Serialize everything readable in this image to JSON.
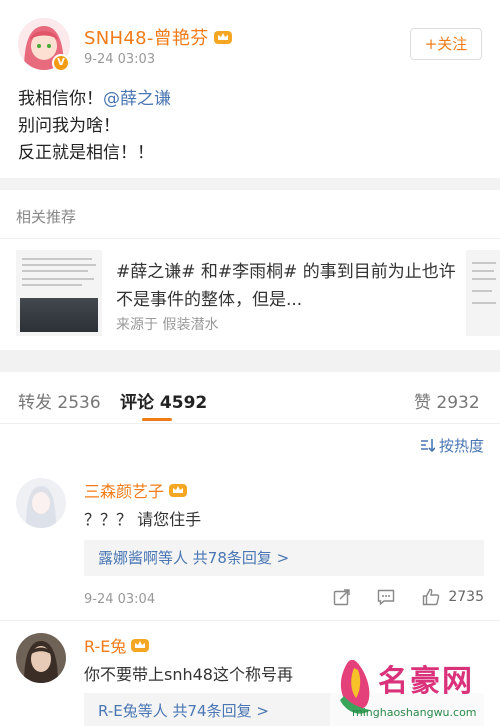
{
  "post": {
    "username": "SNH48-曾艳芬",
    "time": "9-24 03:03",
    "follow_label": "+关注",
    "lines": [
      "我相信你！",
      "别问我为啥！",
      "反正就是相信！！"
    ],
    "mention": "@薛之谦"
  },
  "related": {
    "title": "相关推荐",
    "card_text": "#薛之谦# 和#李雨桐# 的事到目前为止也许不是事件的整体，但是...",
    "card_source": "来源于 假装潜水"
  },
  "tabs": {
    "repost_label": "转发",
    "repost_count": "2536",
    "comment_label": "评论",
    "comment_count": "4592",
    "like_label": "赞",
    "like_count": "2932"
  },
  "sort": {
    "label": "按热度"
  },
  "comments": [
    {
      "name": "三森颜艺子",
      "text": "？？？ 请您住手",
      "reply_users": "露娜酱啊等人",
      "reply_count": "共78条回复 >",
      "time": "9-24 03:04",
      "likes": "2735"
    },
    {
      "name": "R-E兔",
      "text": "你不要带上snh48这个称号再",
      "reply_users": "R-E兔等人",
      "reply_count": "共74条回复 >"
    }
  ],
  "watermark": {
    "name": "名豪网",
    "url": "minghaoshangwu.com"
  }
}
